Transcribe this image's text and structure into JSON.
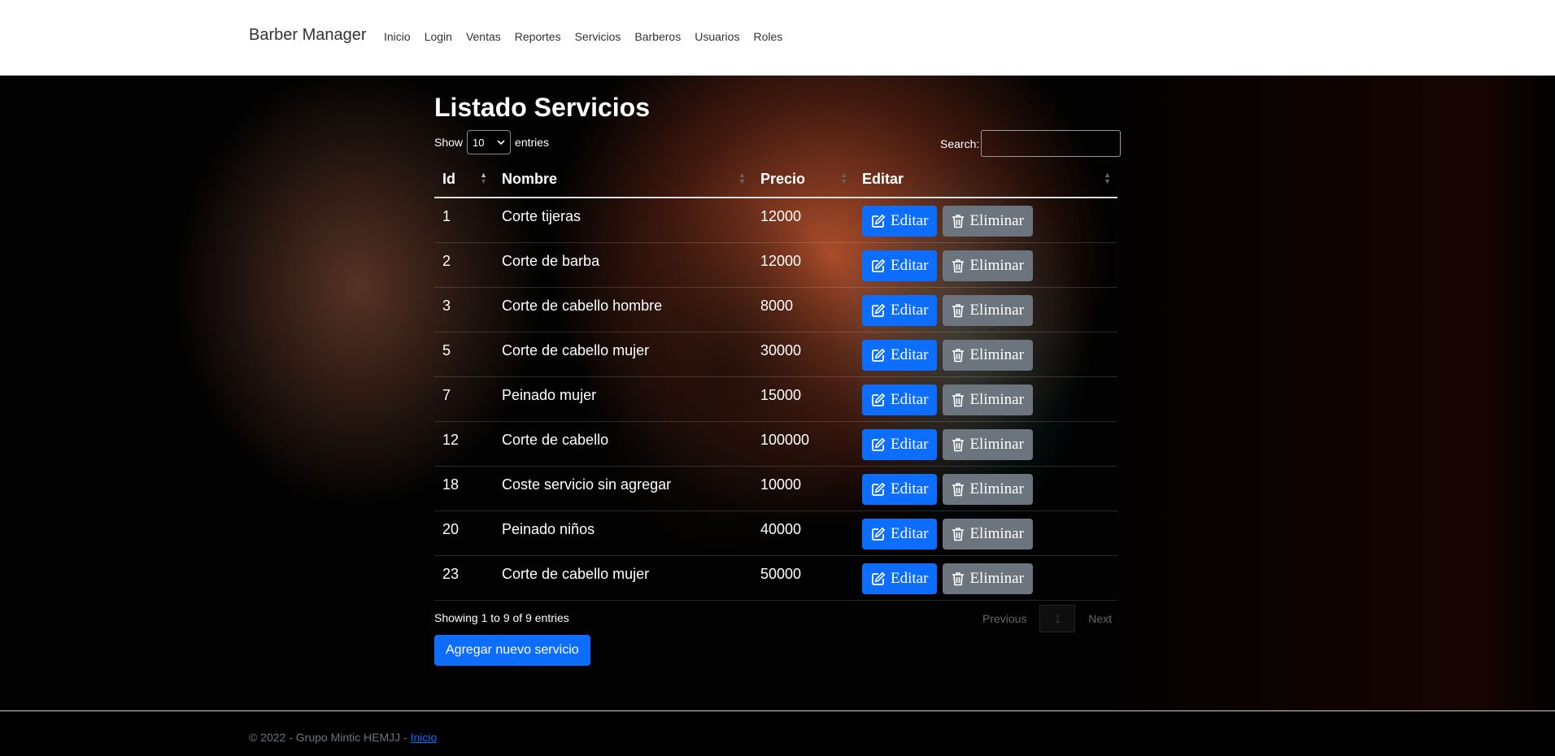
{
  "navbar": {
    "brand": "Barber Manager",
    "links": [
      "Inicio",
      "Login",
      "Ventas",
      "Reportes",
      "Servicios",
      "Barberos",
      "Usuarios",
      "Roles"
    ]
  },
  "main": {
    "title": "Listado Servicios",
    "show_label": "Show",
    "entries_value": "10",
    "entries_label": "entries",
    "search_label": "Search:",
    "search_value": "",
    "columns": [
      "Id",
      "Nombre",
      "Precio",
      "Editar"
    ],
    "rows": [
      {
        "id": "1",
        "nombre": "Corte tijeras",
        "precio": "12000"
      },
      {
        "id": "2",
        "nombre": "Corte de barba",
        "precio": "12000"
      },
      {
        "id": "3",
        "nombre": "Corte de cabello hombre",
        "precio": "8000"
      },
      {
        "id": "5",
        "nombre": "Corte de cabello mujer",
        "precio": "30000"
      },
      {
        "id": "7",
        "nombre": "Peinado mujer",
        "precio": "15000"
      },
      {
        "id": "12",
        "nombre": "Corte de cabello",
        "precio": "100000"
      },
      {
        "id": "18",
        "nombre": "Coste servicio sin agregar",
        "precio": "10000"
      },
      {
        "id": "20",
        "nombre": "Peinado niños",
        "precio": "40000"
      },
      {
        "id": "23",
        "nombre": "Corte de cabello mujer",
        "precio": "50000"
      }
    ],
    "edit_label": "Editar",
    "delete_label": "Eliminar",
    "info": "Showing 1 to 9 of 9 entries",
    "pagination": {
      "previous": "Previous",
      "current": "1",
      "next": "Next"
    },
    "add_button": "Agregar nuevo servicio"
  },
  "footer": {
    "text": "© 2022 - Grupo Mintic HEMJJ - ",
    "link": "Inicio"
  },
  "colors": {
    "primary": "#0d6efd",
    "secondary": "#6c757d"
  }
}
